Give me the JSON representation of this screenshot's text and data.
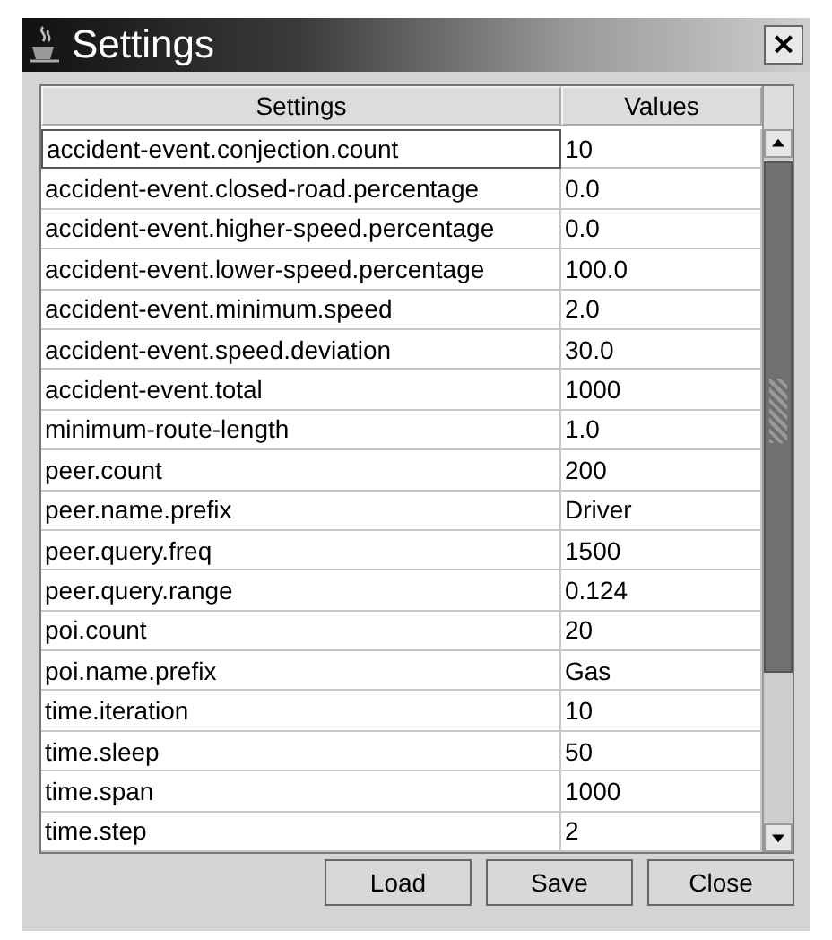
{
  "window": {
    "title": "Settings",
    "close": "×"
  },
  "table": {
    "columns": [
      "Settings",
      "Values"
    ],
    "rows": [
      {
        "setting": "accident-event.conjection.count",
        "value": "10",
        "selected": true
      },
      {
        "setting": "accident-event.closed-road.percentage",
        "value": "0.0",
        "selected": false
      },
      {
        "setting": "accident-event.higher-speed.percentage",
        "value": "0.0",
        "selected": false
      },
      {
        "setting": "accident-event.lower-speed.percentage",
        "value": "100.0",
        "selected": false
      },
      {
        "setting": "accident-event.minimum.speed",
        "value": "2.0",
        "selected": false
      },
      {
        "setting": "accident-event.speed.deviation",
        "value": "30.0",
        "selected": false
      },
      {
        "setting": "accident-event.total",
        "value": "1000",
        "selected": false
      },
      {
        "setting": "minimum-route-length",
        "value": "1.0",
        "selected": false
      },
      {
        "setting": "peer.count",
        "value": "200",
        "selected": false
      },
      {
        "setting": "peer.name.prefix",
        "value": "Driver",
        "selected": false
      },
      {
        "setting": "peer.query.freq",
        "value": "1500",
        "selected": false
      },
      {
        "setting": "peer.query.range",
        "value": "0.124",
        "selected": false
      },
      {
        "setting": "poi.count",
        "value": "20",
        "selected": false
      },
      {
        "setting": "poi.name.prefix",
        "value": "Gas",
        "selected": false
      },
      {
        "setting": "time.iteration",
        "value": "10",
        "selected": false
      },
      {
        "setting": "time.sleep",
        "value": "50",
        "selected": false
      },
      {
        "setting": "time.span",
        "value": "1000",
        "selected": false
      },
      {
        "setting": "time.step",
        "value": "2",
        "selected": false
      }
    ]
  },
  "buttons": [
    "Load",
    "Save",
    "Close"
  ]
}
